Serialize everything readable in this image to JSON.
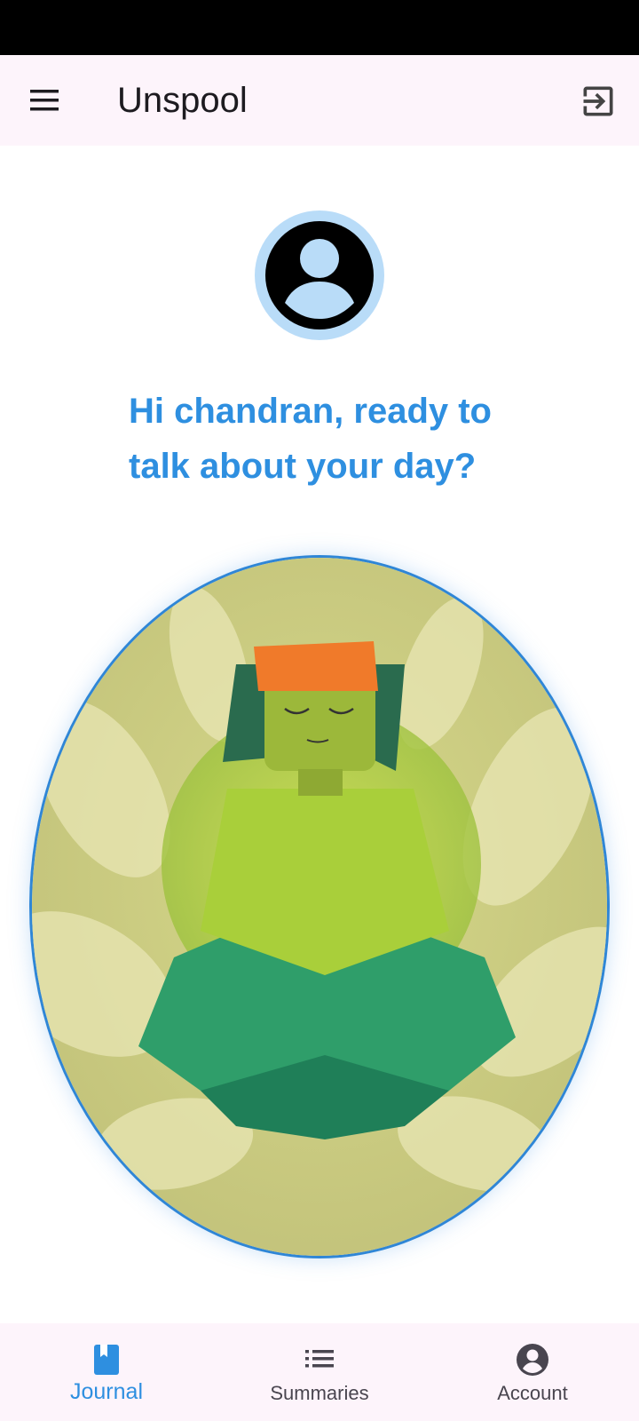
{
  "app_bar": {
    "title": "Unspool",
    "menu_icon": "hamburger-menu-icon",
    "logout_icon": "exit-to-app-icon"
  },
  "main": {
    "avatar_icon": "account-circle-icon",
    "greeting": "Hi chandran, ready to talk about your day?"
  },
  "bottom_nav": {
    "items": [
      {
        "label": "Journal",
        "icon": "book-icon",
        "active": true
      },
      {
        "label": "Summaries",
        "icon": "list-icon",
        "active": false
      },
      {
        "label": "Account",
        "icon": "account-circle-icon",
        "active": false
      }
    ]
  },
  "colors": {
    "accent": "#2e8fe0",
    "app_bar_bg": "#fdf4fb",
    "avatar_ring": "#b9dcf8"
  }
}
